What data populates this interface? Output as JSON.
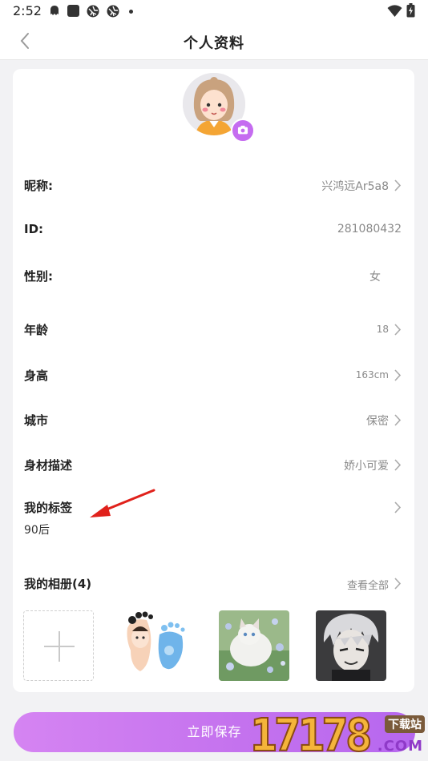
{
  "status_bar": {
    "time": "2:52",
    "icons": [
      "ghost-icon",
      "square-app-icon",
      "aperture-icon",
      "aperture-icon",
      "dot-icon",
      "wifi-icon",
      "battery-icon"
    ]
  },
  "navbar": {
    "back_icon": "chevron-left-icon",
    "title": "个人资料"
  },
  "profile": {
    "avatar_icon": "cartoon-girl-avatar",
    "camera_icon": "camera-icon",
    "rows": [
      {
        "label": "昵称:",
        "value": "兴鸿远Ar5a8",
        "chevron": true
      },
      {
        "label": "ID:",
        "value": "281080432",
        "chevron": false
      },
      {
        "label": "性别:",
        "value": "女",
        "chevron": false
      },
      {
        "label": "年龄",
        "value": "18",
        "chevron": true
      },
      {
        "label": "身高",
        "value": "163cm",
        "chevron": true
      },
      {
        "label": "城市",
        "value": "保密",
        "chevron": true
      },
      {
        "label": "身材描述",
        "value": "娇小可爱",
        "chevron": true
      },
      {
        "label": "我的标签",
        "value": "",
        "chevron": true
      }
    ],
    "tags": "90后"
  },
  "album": {
    "title": "我的相册(4)",
    "view_all": "查看全部",
    "photos": [
      "add-photo",
      "baby-footprint-photo",
      "white-cat-flowers-photo",
      "anime-boy-photo"
    ]
  },
  "save_button": "立即保存",
  "watermark": {
    "digits": "17178",
    "top": "下载站",
    "bottom": ".COM"
  },
  "colors": {
    "accent": "#c56cf0",
    "button_gradient": [
      "#d584f2",
      "#b667ef"
    ],
    "annotation_arrow": "#e0211b"
  }
}
